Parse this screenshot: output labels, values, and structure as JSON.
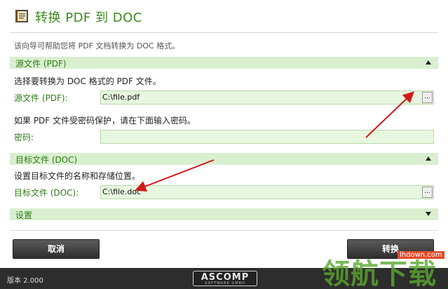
{
  "header": {
    "title": "转换 PDF 到 DOC"
  },
  "subtitle": "该向导可帮助您将 PDF 文档转换为 DOC 格式。",
  "source_section": {
    "title": "源文件 (PDF)",
    "description": "选择要转换为 DOC 格式的 PDF 文件。",
    "file_label": "源文件 (PDF):",
    "file_value": "C:\\file.pdf",
    "password_note": "如果 PDF 文件受密码保护，请在下面输入密码。",
    "password_label": "密码:",
    "password_value": ""
  },
  "target_section": {
    "title": "目标文件 (DOC)",
    "description": "设置目标文件的名称和存储位置。",
    "file_label": "目标文件 (DOC):",
    "file_value": "C:\\file.doc"
  },
  "settings_section": {
    "title": "设置"
  },
  "browse_label": "...",
  "buttons": {
    "cancel": "取消",
    "convert": "转换"
  },
  "status": {
    "version": "版本 2.000"
  },
  "logo": {
    "brand": "ASCOMP",
    "tagline": "SOFTWARE GMBH"
  },
  "watermark": {
    "text": "领航下载",
    "url": "lhdown.com"
  },
  "colors": {
    "accent": "#3b8a1e",
    "section_bg": "#d9efcf",
    "field_bg": "#e7f6de",
    "arrow": "#d11a1a",
    "statusbar": "#2d2d2d"
  }
}
